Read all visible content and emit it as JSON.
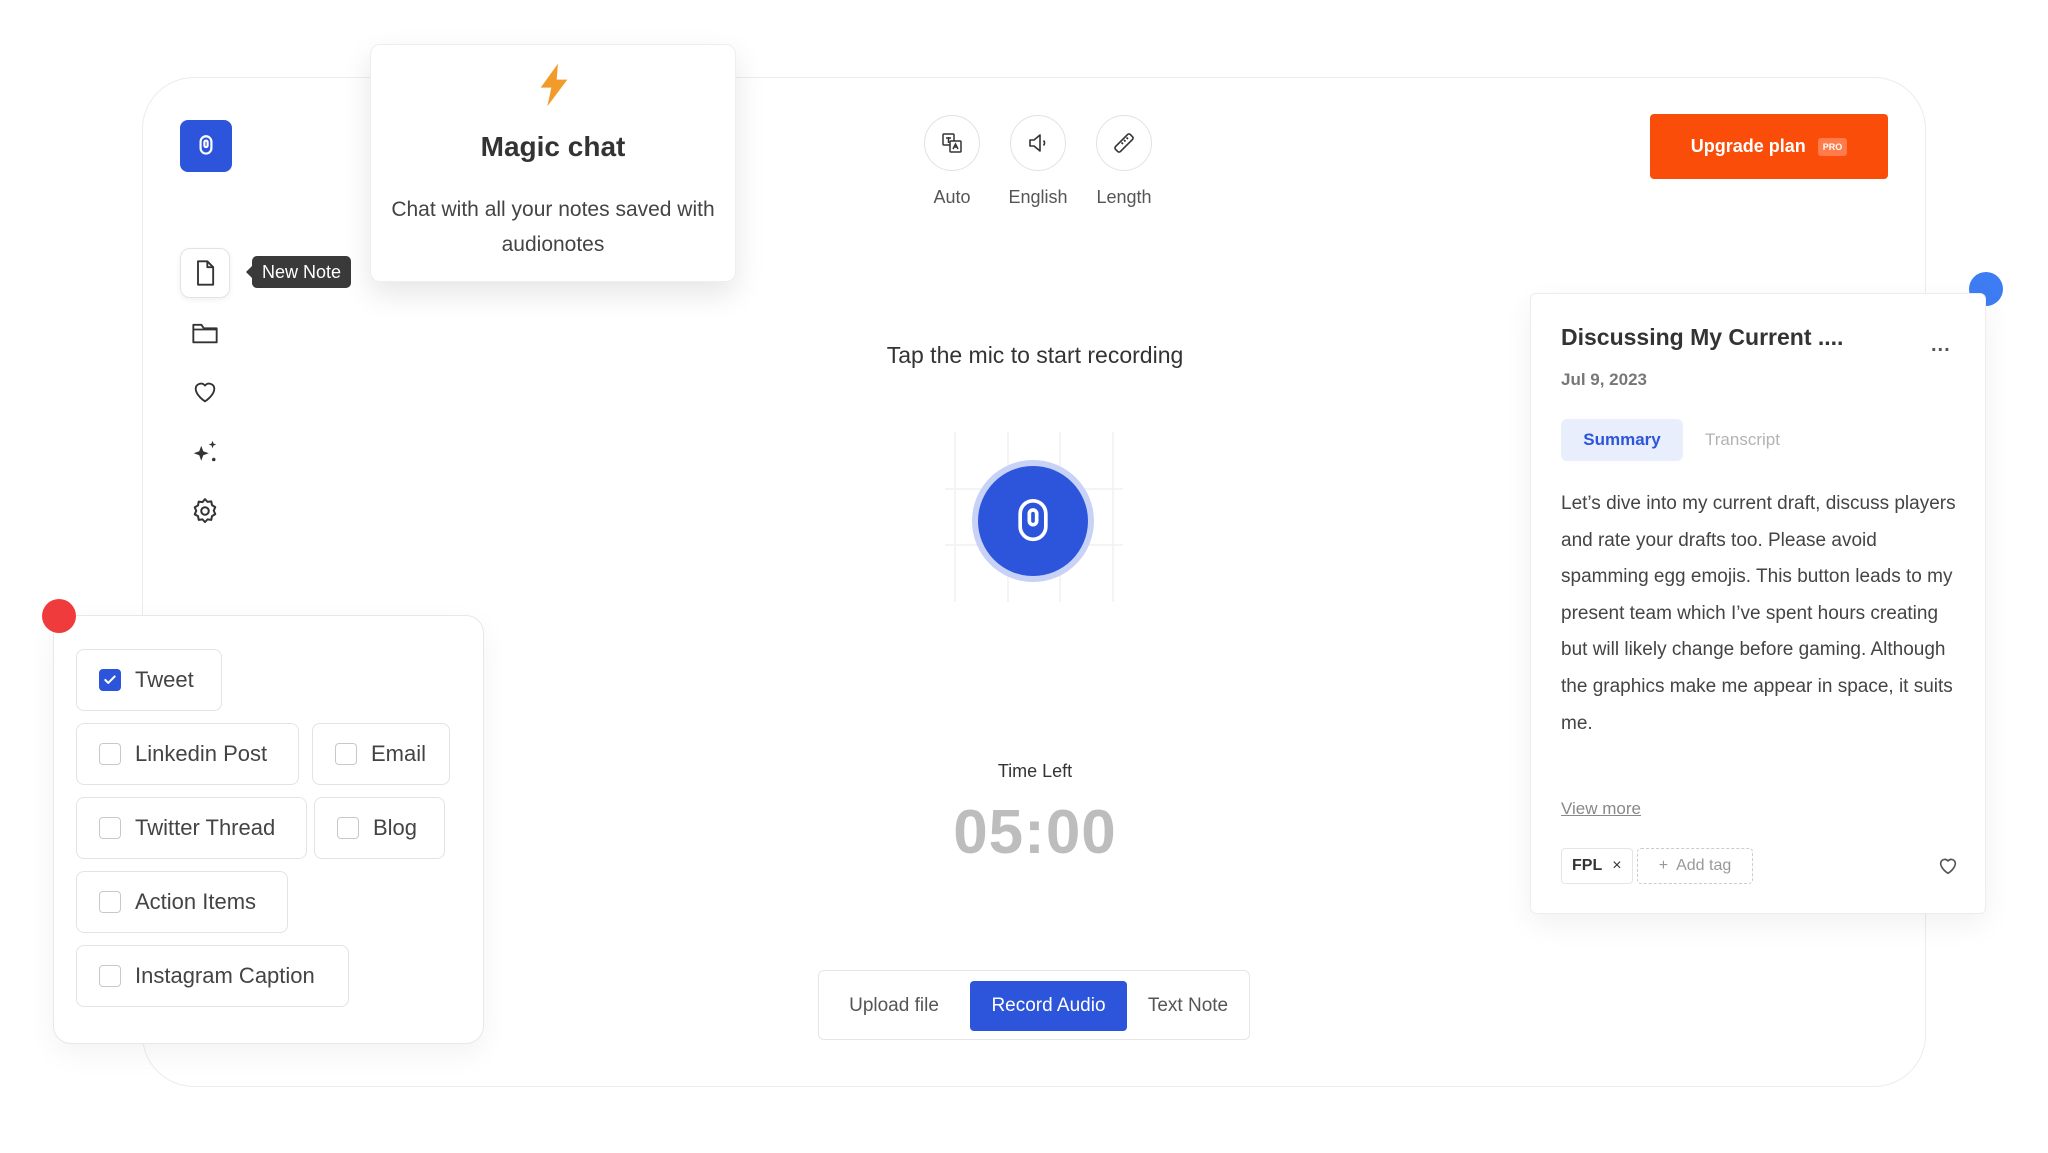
{
  "magic_chat": {
    "title": "Magic chat",
    "description": "Chat with all your notes saved with audionotes"
  },
  "sidebar": {
    "tooltip": "New Note",
    "items": [
      {
        "icon": "file-icon"
      },
      {
        "icon": "folder-icon"
      },
      {
        "icon": "heart-icon"
      },
      {
        "icon": "sparkles-icon"
      },
      {
        "icon": "gear-icon"
      }
    ]
  },
  "toolbar": {
    "tools": [
      {
        "label": "Auto",
        "icon": "translate-icon"
      },
      {
        "label": "English",
        "icon": "speaker-icon"
      },
      {
        "label": "Length",
        "icon": "ruler-icon"
      }
    ],
    "upgrade_label": "Upgrade plan",
    "pro_badge": "PRO"
  },
  "recorder": {
    "prompt": "Tap the mic to start recording",
    "time_left_label": "Time Left",
    "time_left_value": "05:00"
  },
  "modes": {
    "upload": "Upload file",
    "record": "Record Audio",
    "text": "Text Note",
    "active": "Record Audio"
  },
  "note": {
    "title": "Discussing My Current ....",
    "date": "Jul 9, 2023",
    "more": "...",
    "tabs": {
      "summary": "Summary",
      "transcript": "Transcript"
    },
    "body": "Let’s dive into my current draft, discuss players and rate your drafts too. Please avoid spamming egg emojis. This button leads to my present team which I’ve spent hours creating but will likely change before gaming. Although the graphics make me appear in space, it suits me.",
    "view_more": "View more",
    "tag": "FPL",
    "tag_remove": "×",
    "add_tag_plus": "+",
    "add_tag": "Add tag"
  },
  "outputs": {
    "items": [
      {
        "label": "Tweet",
        "checked": true
      },
      {
        "label": "Linkedin Post",
        "checked": false
      },
      {
        "label": "Email",
        "checked": false
      },
      {
        "label": "Twitter Thread",
        "checked": false
      },
      {
        "label": "Blog",
        "checked": false
      },
      {
        "label": "Action Items",
        "checked": false
      },
      {
        "label": "Instagram Caption",
        "checked": false
      }
    ]
  },
  "colors": {
    "primary": "#2d55db",
    "accent_orange": "#fa4d0a",
    "dot_blue": "#3d7cf2",
    "dot_red": "#ef3b3b"
  }
}
